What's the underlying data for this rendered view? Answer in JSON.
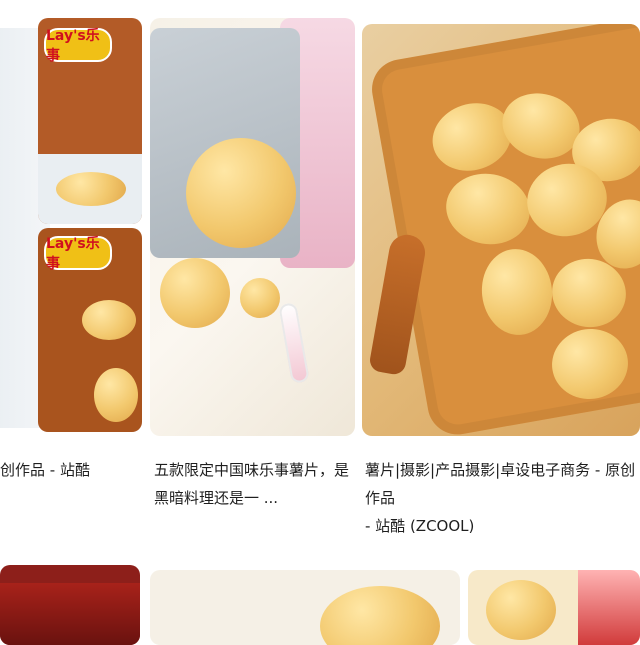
{
  "results": [
    {
      "id": "left-partial",
      "caption": "创作品 - 站酷",
      "brand_logo_text": "Lay's乐事"
    },
    {
      "id": "middle",
      "caption_line1": "五款限定中国味乐事薯片，是",
      "caption_line2": "黑暗料理还是一 ..."
    },
    {
      "id": "right",
      "caption_line1": "薯片|摄影|产品摄影|卓设电子商务 - 原创作品",
      "caption_line2": "- 站酷 (ZCOOL)"
    }
  ],
  "colors": {
    "bag_brown": "#b35b27",
    "chip_yellow": "#f2c86d",
    "board_wood": "#d98f3d",
    "caption_text": "#1f1f1f"
  },
  "icons": {
    "brand_logo": "lays-logo-icon"
  }
}
